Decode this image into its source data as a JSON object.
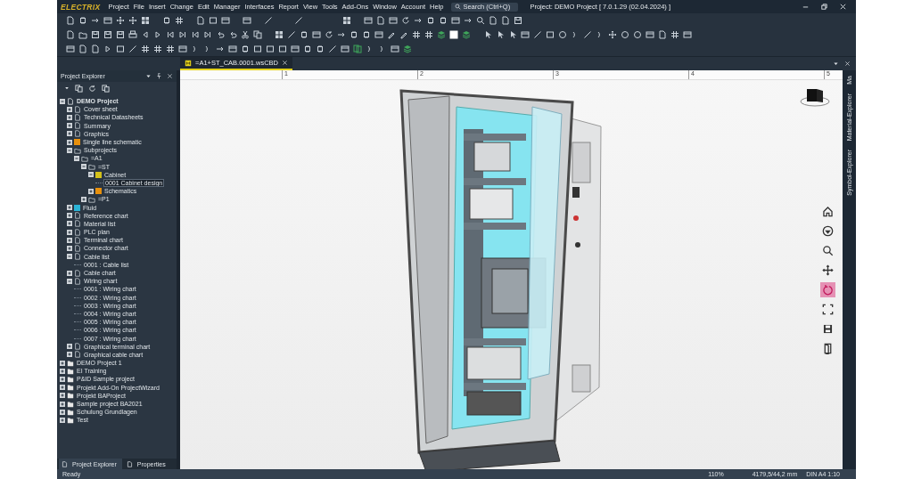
{
  "window": {
    "logo": "ELECTRIX",
    "title": "Project: DEMO Project [ 7.0.1.29 (02.04.2024) ]"
  },
  "menu": [
    "Project",
    "File",
    "Insert",
    "Change",
    "Edit",
    "Manager",
    "Interfaces",
    "Report",
    "View",
    "Tools",
    "Add-Ons",
    "Window",
    "Account",
    "Help"
  ],
  "search": {
    "placeholder": "Search (Ctrl+Q)"
  },
  "document_tab": {
    "label": "=A1+ST_CAB.0001.wsCBD",
    "selected": true
  },
  "explorer": {
    "title": "Project Explorer",
    "tree": [
      {
        "label": "DEMO Project",
        "kind": "project",
        "expanded": true,
        "selected": false,
        "children": [
          {
            "label": "Cover sheet",
            "kind": "page",
            "expanded": false,
            "selected": false
          },
          {
            "label": "Technical Datasheets",
            "kind": "page",
            "expanded": false,
            "selected": false
          },
          {
            "label": "Summary",
            "kind": "page",
            "expanded": false,
            "selected": false
          },
          {
            "label": "Graphics",
            "kind": "page",
            "expanded": false,
            "selected": false
          },
          {
            "label": "Single line schematic",
            "kind": "page",
            "color": "#e8900c",
            "expanded": false,
            "selected": false
          },
          {
            "label": "Subprojects",
            "kind": "folder",
            "expanded": true,
            "selected": false,
            "children": [
              {
                "label": "=A1",
                "kind": "folder",
                "expanded": true,
                "selected": false,
                "children": [
                  {
                    "label": "=ST",
                    "kind": "folder",
                    "expanded": true,
                    "selected": false,
                    "children": [
                      {
                        "label": "Cabinet",
                        "kind": "page",
                        "color": "#d4c21a",
                        "expanded": true,
                        "selected": false,
                        "children": [
                          {
                            "label": "0001 Cabinet design",
                            "kind": "leaf",
                            "selected": true
                          }
                        ]
                      },
                      {
                        "label": "Schematics",
                        "kind": "page",
                        "color": "#e8900c",
                        "expanded": false,
                        "selected": false
                      }
                    ]
                  },
                  {
                    "label": "=P1",
                    "kind": "folder",
                    "expanded": false,
                    "selected": false
                  }
                ]
              }
            ]
          },
          {
            "label": "Fluid",
            "kind": "page",
            "color": "#2ab3d6",
            "expanded": false,
            "selected": false
          },
          {
            "label": "Reference chart",
            "kind": "page",
            "expanded": false,
            "selected": false
          },
          {
            "label": "Material list",
            "kind": "page",
            "expanded": false,
            "selected": false
          },
          {
            "label": "PLC plan",
            "kind": "page",
            "expanded": false,
            "selected": false
          },
          {
            "label": "Terminal chart",
            "kind": "page",
            "expanded": false,
            "selected": false
          },
          {
            "label": "Connector chart",
            "kind": "page",
            "expanded": false,
            "selected": false
          },
          {
            "label": "Cable list",
            "kind": "page",
            "expanded": true,
            "selected": false,
            "children": [
              {
                "label": "0001 : Cable list",
                "kind": "leaf",
                "selected": false
              }
            ]
          },
          {
            "label": "Cable chart",
            "kind": "page",
            "expanded": false,
            "selected": false
          },
          {
            "label": "Wiring chart",
            "kind": "page",
            "expanded": true,
            "selected": false,
            "children": [
              {
                "label": "0001 : Wiring chart",
                "kind": "leaf",
                "selected": false
              },
              {
                "label": "0002 : Wiring chart",
                "kind": "leaf",
                "selected": false
              },
              {
                "label": "0003 : Wiring chart",
                "kind": "leaf",
                "selected": false
              },
              {
                "label": "0004 : Wiring chart",
                "kind": "leaf",
                "selected": false
              },
              {
                "label": "0005 : Wiring chart",
                "kind": "leaf",
                "selected": false
              },
              {
                "label": "0006 : Wiring chart",
                "kind": "leaf",
                "selected": false
              },
              {
                "label": "0007 : Wiring chart",
                "kind": "leaf",
                "selected": false
              }
            ]
          },
          {
            "label": "Graphical terminal chart",
            "kind": "page",
            "expanded": false,
            "selected": false
          },
          {
            "label": "Graphical cable chart",
            "kind": "page",
            "expanded": false,
            "selected": false
          }
        ]
      },
      {
        "label": "DEMO Project 1",
        "kind": "closed-project",
        "expanded": false,
        "selected": false
      },
      {
        "label": "EI Training",
        "kind": "closed-project",
        "expanded": false,
        "selected": false
      },
      {
        "label": "P&ID Sample project",
        "kind": "closed-project",
        "expanded": false,
        "selected": false
      },
      {
        "label": "Projekt Add-On ProjectWizard",
        "kind": "closed-project",
        "expanded": false,
        "selected": false
      },
      {
        "label": "Projekt BAProject",
        "kind": "closed-project",
        "expanded": false,
        "selected": false
      },
      {
        "label": "Sample project BA2021",
        "kind": "closed-project",
        "expanded": false,
        "selected": false
      },
      {
        "label": "Schulung Grundlagen",
        "kind": "closed-project",
        "expanded": false,
        "selected": false
      },
      {
        "label": "Test",
        "kind": "closed-project",
        "expanded": false,
        "selected": false
      }
    ],
    "bottom_tabs": [
      {
        "label": "Project Explorer",
        "selected": true
      },
      {
        "label": "Properties",
        "selected": false
      }
    ]
  },
  "ruler_labels": [
    "1",
    "2",
    "3",
    "4",
    "5"
  ],
  "view_tools": [
    {
      "kind": "home",
      "selected": false
    },
    {
      "kind": "view",
      "selected": false
    },
    {
      "kind": "zoom",
      "selected": false
    },
    {
      "kind": "pan",
      "selected": false
    },
    {
      "kind": "rotate",
      "selected": true
    },
    {
      "kind": "fit",
      "selected": false
    },
    {
      "kind": "save",
      "selected": false
    },
    {
      "kind": "exit",
      "selected": false
    }
  ],
  "side_tabs": [
    "Ma",
    "Material-Explorer",
    "Symbol-Explorer"
  ],
  "status_bar": {
    "message": "Ready",
    "zoom": "110%",
    "coordinates": "4179,5/44,2 mm",
    "format": "DIN A4 1:10"
  }
}
